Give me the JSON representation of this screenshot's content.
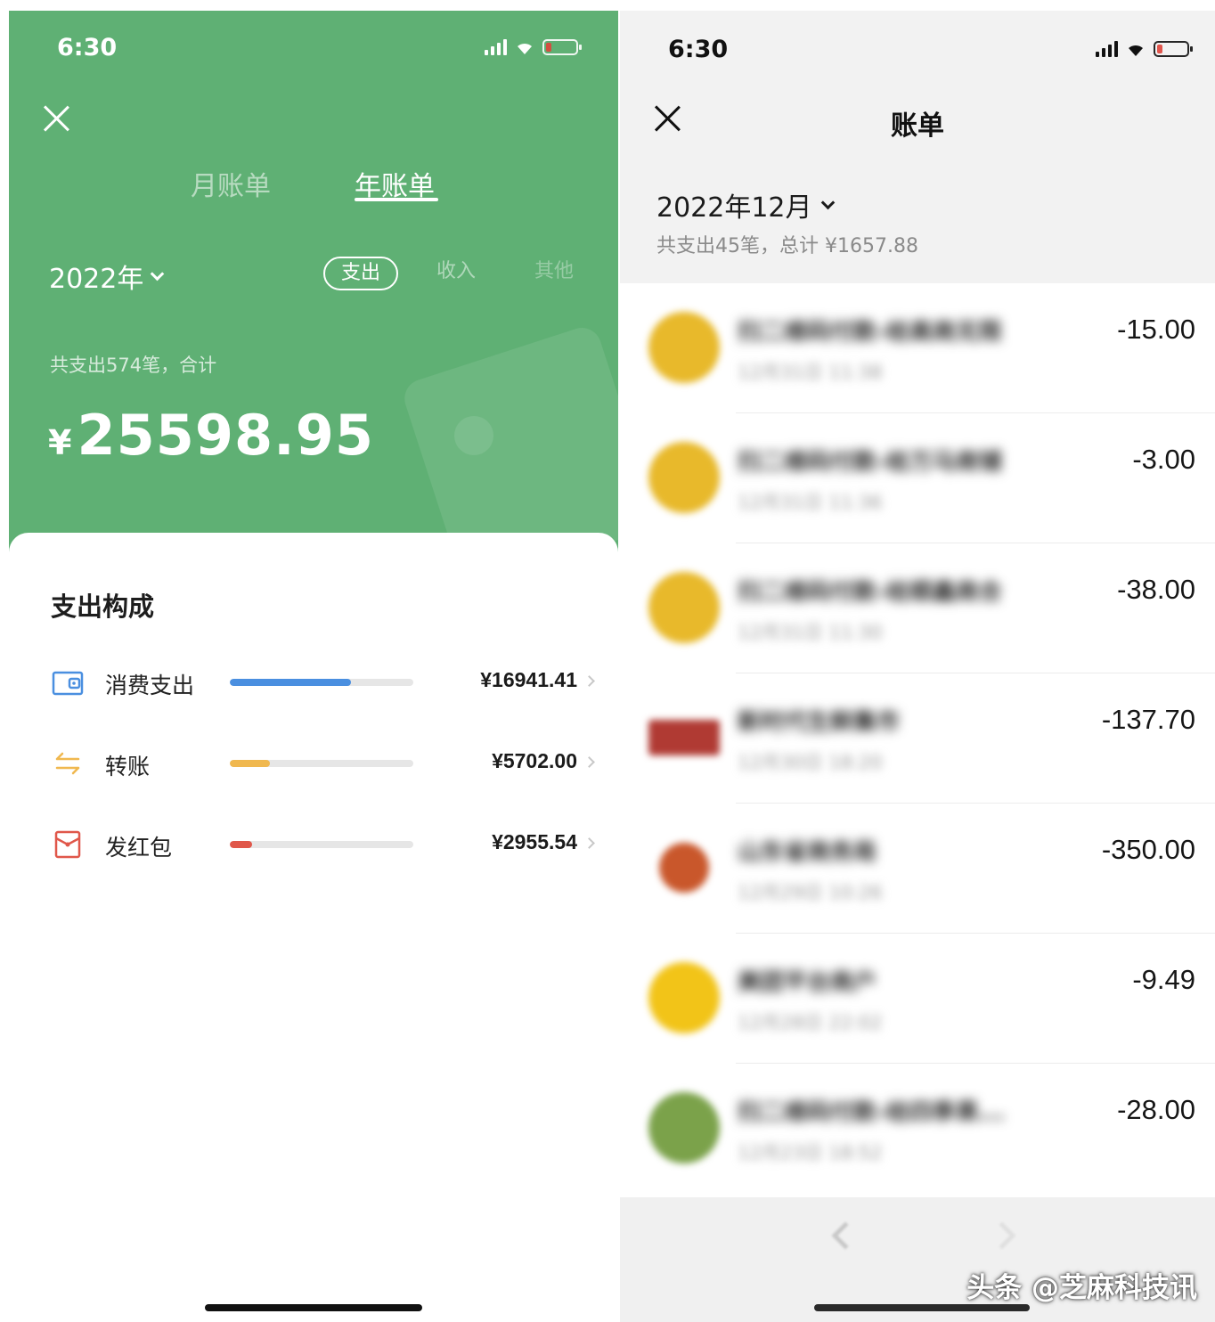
{
  "left_screen": {
    "status_time": "6:30",
    "tabs": [
      {
        "label": "月账单",
        "active": false
      },
      {
        "label": "年账单",
        "active": true
      }
    ],
    "year_selector": "2022年",
    "filter_pills": [
      "支出",
      "收入",
      "其他"
    ],
    "total_label": "共支出574笔，合计",
    "currency_symbol": "¥",
    "total_amount": "25598.95",
    "section_title": "支出构成",
    "categories": [
      {
        "label": "消费支出",
        "amount": "¥16941.41",
        "icon": "wallet-icon",
        "color": "#4a8fe0",
        "share": 0.66
      },
      {
        "label": "转账",
        "amount": "¥5702.00",
        "icon": "transfer-arrows-icon",
        "color": "#f0b84f",
        "share": 0.22
      },
      {
        "label": "发红包",
        "amount": "¥2955.54",
        "icon": "red-envelope-icon",
        "color": "#e0574a",
        "share": 0.12
      }
    ],
    "accent_color": "#5fb074"
  },
  "right_screen": {
    "status_time": "6:30",
    "title": "账单",
    "month_selector": "2022年12月",
    "month_summary": "共支出45笔，总计 ¥1657.88",
    "transactions": [
      {
        "merchant": "扫二维码付款-给高商无限",
        "time": "12月31日 11:38",
        "amount": "-15.00",
        "avatar_color": "#e8b92b"
      },
      {
        "merchant": "扫二维码付款-给万马商铺",
        "time": "12月31日 11:36",
        "amount": "-3.00",
        "avatar_color": "#e8b92b"
      },
      {
        "merchant": "扫二维码付款-给顺鑫商合",
        "time": "12月31日 11:30",
        "amount": "-38.00",
        "avatar_color": "#e8b92b"
      },
      {
        "merchant": "新时代生鲜集市",
        "time": "12月30日 18:20",
        "amount": "-137.70",
        "avatar_color": "#b03a33"
      },
      {
        "merchant": "山东省商务局",
        "time": "12月29日 10:26",
        "amount": "-350.00",
        "avatar_color": "#c9572b"
      },
      {
        "merchant": "美团平台商户",
        "time": "12月28日 22:02",
        "amount": "-9.49",
        "avatar_color": "#f2c418"
      },
      {
        "merchant": "扫二维码付款-给四季果...",
        "time": "12月23日 18:52",
        "amount": "-28.00",
        "avatar_color": "#7ba24a"
      }
    ]
  },
  "watermark": "头条 @芝麻科技讯"
}
